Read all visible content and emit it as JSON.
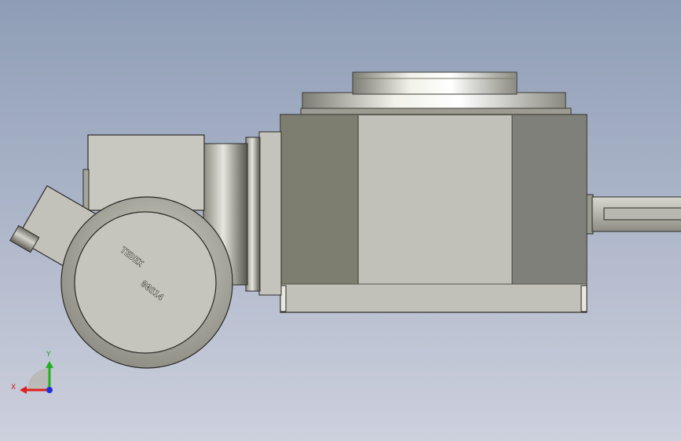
{
  "viewport": {
    "background_top": "#8e9db6",
    "background_bottom": "#cdd0dd"
  },
  "part": {
    "engraving_brand": "TEDEX",
    "engraving_model": "80S14"
  },
  "triad": {
    "x_label": "X",
    "y_label": "Y",
    "x_color": "#e02020",
    "y_color": "#20b020",
    "z_color": "#2030e0"
  }
}
